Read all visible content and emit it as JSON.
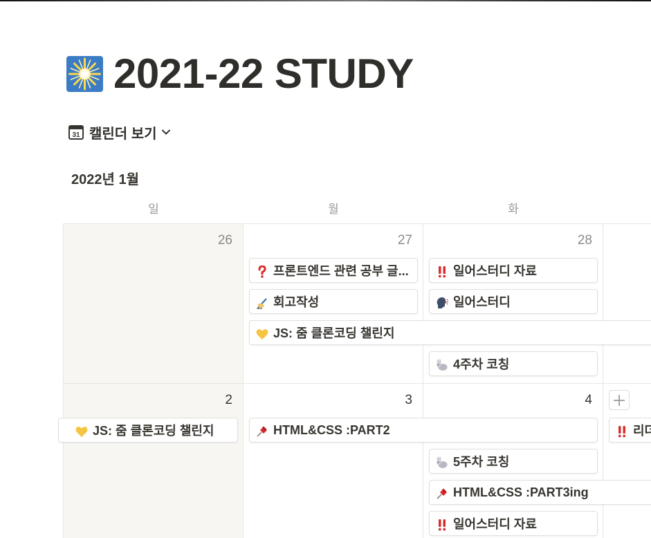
{
  "page": {
    "title": "2021-22 STUDY",
    "icon": "sparkle-icon"
  },
  "view": {
    "label": "캘린더 보기",
    "icon": "calendar-31-icon",
    "calendar_icon_text": "31"
  },
  "calendar": {
    "month_label": "2022년 1월",
    "weekdays": [
      "일",
      "월",
      "화"
    ],
    "week1": {
      "days": [
        "26",
        "27",
        "28"
      ]
    },
    "week2": {
      "days": [
        "2",
        "3",
        "4"
      ]
    }
  },
  "events": {
    "e1": {
      "title": "프론트엔드 관련 공부 글...",
      "icon": "question-mark-icon"
    },
    "e2": {
      "title": "일어스터디 자료",
      "icon": "double-exclamation-icon"
    },
    "e3": {
      "title": "회고작성",
      "icon": "writing-hand-icon"
    },
    "e4": {
      "title": "일어스터디",
      "icon": "speaking-head-icon"
    },
    "e5": {
      "title": "JS: 줌 클론코딩 챌린지",
      "icon": "yellow-heart-icon"
    },
    "e6": {
      "title": "4주차 코칭",
      "icon": "rabbit-icon"
    },
    "e7": {
      "title": "JS: 줌 클론코딩 챌린지",
      "icon": "yellow-heart-icon"
    },
    "e8": {
      "title": "HTML&CSS :PART2",
      "icon": "pushpin-icon"
    },
    "e9": {
      "title": "리더",
      "icon": "double-exclamation-icon"
    },
    "e10": {
      "title": "5주차 코칭",
      "icon": "rabbit-icon"
    },
    "e11": {
      "title": "HTML&CSS :PART3ing",
      "icon": "pushpin-icon"
    },
    "e12": {
      "title": "일어스터디 자료",
      "icon": "double-exclamation-icon"
    }
  },
  "colors": {
    "text": "#37352f",
    "muted": "#9b9a97",
    "weekend_bg": "#f7f6f3",
    "grid": "#e6e6e4",
    "heart": "#f5c542",
    "exclaim": "#d92d2d",
    "pin": "#d6292e"
  }
}
